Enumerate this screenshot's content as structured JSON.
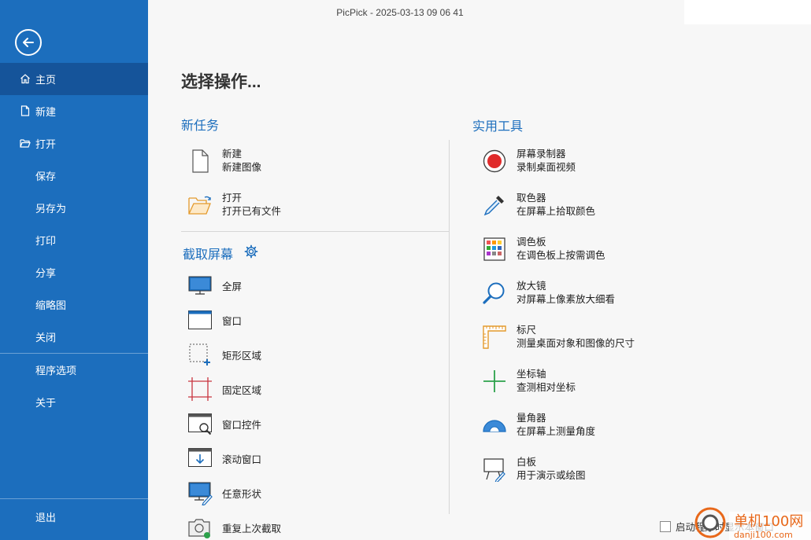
{
  "window": {
    "title": "PicPick - 2025-03-13 09 06 41"
  },
  "sidebar": {
    "items": [
      {
        "label": "主页",
        "icon": "home-icon"
      },
      {
        "label": "新建",
        "icon": "new-file-icon"
      },
      {
        "label": "打开",
        "icon": "folder-open-icon"
      },
      {
        "label": "保存"
      },
      {
        "label": "另存为"
      },
      {
        "label": "打印"
      },
      {
        "label": "分享"
      },
      {
        "label": "缩略图"
      },
      {
        "label": "关闭"
      },
      {
        "label": "程序选项"
      },
      {
        "label": "关于"
      }
    ],
    "exit_label": "退出"
  },
  "main": {
    "heading": "选择操作...",
    "new_task": {
      "title": "新任务",
      "items": [
        {
          "title": "新建",
          "desc": "新建图像",
          "icon": "blank-page-icon"
        },
        {
          "title": "打开",
          "desc": "打开已有文件",
          "icon": "open-folder-icon"
        }
      ]
    },
    "capture": {
      "title": "截取屏幕",
      "items": [
        {
          "label": "全屏",
          "icon": "fullscreen-icon"
        },
        {
          "label": "窗口",
          "icon": "window-icon"
        },
        {
          "label": "矩形区域",
          "icon": "rect-region-icon"
        },
        {
          "label": "固定区域",
          "icon": "fixed-region-icon"
        },
        {
          "label": "窗口控件",
          "icon": "window-control-icon"
        },
        {
          "label": "滚动窗口",
          "icon": "scroll-window-icon"
        },
        {
          "label": "任意形状",
          "icon": "freehand-icon"
        },
        {
          "label": "重复上次截取",
          "icon": "camera-repeat-icon"
        }
      ]
    },
    "tools": {
      "title": "实用工具",
      "items": [
        {
          "title": "屏幕录制器",
          "desc": "录制桌面视频",
          "icon": "record-icon"
        },
        {
          "title": "取色器",
          "desc": "在屏幕上拾取颜色",
          "icon": "eyedropper-icon"
        },
        {
          "title": "调色板",
          "desc": "在调色板上按需调色",
          "icon": "palette-icon"
        },
        {
          "title": "放大镜",
          "desc": "对屏幕上像素放大细看",
          "icon": "magnifier-icon"
        },
        {
          "title": "标尺",
          "desc": "测量桌面对象和图像的尺寸",
          "icon": "ruler-icon"
        },
        {
          "title": "坐标轴",
          "desc": "查测相对坐标",
          "icon": "crosshair-icon"
        },
        {
          "title": "量角器",
          "desc": "在屏幕上测量角度",
          "icon": "protractor-icon"
        },
        {
          "title": "白板",
          "desc": "用于演示或绘图",
          "icon": "whiteboard-icon"
        }
      ]
    }
  },
  "footer": {
    "startup_label": "启动程序时显示本窗口",
    "startup_checked": false
  },
  "watermark": {
    "text": "单机100网",
    "sub": "danji100.com"
  },
  "colors": {
    "sidebar": "#1c6ebd",
    "sidebar_active": "#15549a",
    "accent": "#1c6ebd"
  }
}
